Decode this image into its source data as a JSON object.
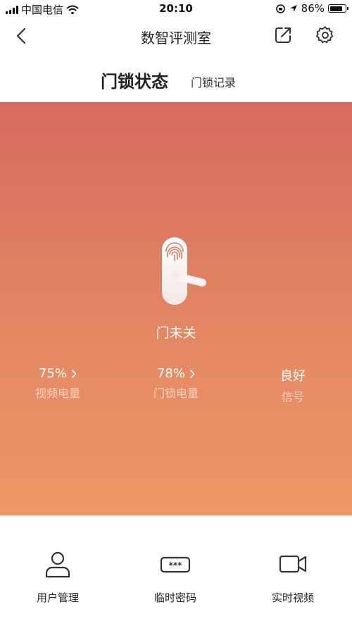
{
  "status_bar": {
    "carrier": "中国电信",
    "time": "20:10",
    "battery_percent": "86%",
    "battery_level": 0.86
  },
  "nav": {
    "title": "数智评测室",
    "back_icon": "chevron-left-icon",
    "share_icon": "share-icon",
    "settings_icon": "gear-icon"
  },
  "tabs": [
    {
      "label": "门锁状态",
      "active": true
    },
    {
      "label": "门锁记录",
      "active": false
    }
  ],
  "lock": {
    "status_text": "门未关",
    "icon": "fingerprint-lock-icon"
  },
  "stats": [
    {
      "value": "75%",
      "label": "视频电量",
      "has_arrow": true
    },
    {
      "value": "78%",
      "label": "门锁电量",
      "has_arrow": true
    },
    {
      "value": "良好",
      "label": "信号",
      "has_arrow": false
    }
  ],
  "actions": [
    {
      "label": "用户管理",
      "icon": "user-icon"
    },
    {
      "label": "临时密码",
      "icon": "password-icon"
    },
    {
      "label": "实时视频",
      "icon": "video-camera-icon"
    }
  ],
  "colors": {
    "gradient_top": "#d76b5f",
    "gradient_bottom": "#ef9865",
    "text": "#222222"
  }
}
